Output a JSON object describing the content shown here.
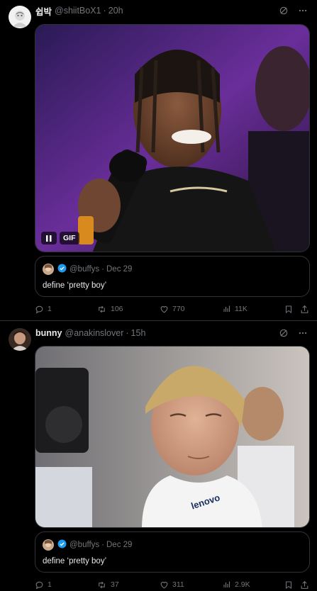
{
  "tweets": [
    {
      "author_name": "쉽박",
      "handle": "@shiitBoX1",
      "separator": "·",
      "time": "20h",
      "media_type_label": "GIF",
      "quote": {
        "handle": "@buffys",
        "separator": "·",
        "date": "Dec 29",
        "text": "define ‘pretty boy’"
      },
      "stats": {
        "replies": "1",
        "reposts": "106",
        "likes": "770",
        "views": "11K"
      }
    },
    {
      "author_name": "bunny",
      "handle": "@anakinslover",
      "separator": "·",
      "time": "15h",
      "quote": {
        "handle": "@buffys",
        "separator": "·",
        "date": "Dec 29",
        "text": "define ‘pretty boy’"
      },
      "stats": {
        "replies": "1",
        "reposts": "37",
        "likes": "311",
        "views": "2.9K"
      }
    }
  ],
  "colors": {
    "background": "#000000",
    "muted": "#71767b",
    "text": "#e7e9ea",
    "verified": "#1d9bf0",
    "border": "#2f3336"
  },
  "icons": [
    "grok-icon",
    "more-icon",
    "pause-icon",
    "verified-icon",
    "reply-icon",
    "repost-icon",
    "like-icon",
    "views-icon",
    "bookmark-icon",
    "share-icon"
  ]
}
